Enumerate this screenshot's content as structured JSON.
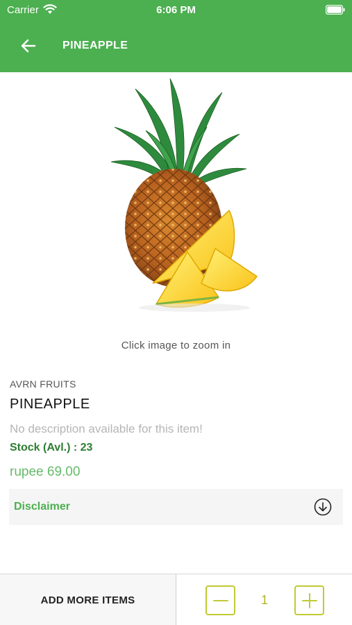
{
  "status_bar": {
    "carrier": "Carrier",
    "time": "6:06 PM"
  },
  "header": {
    "title": "PINEAPPLE",
    "back_icon": "arrow-left-icon"
  },
  "product": {
    "image_alt": "pineapple",
    "zoom_hint": "Click image to zoom in",
    "brand": "AVRN FRUITS",
    "name": "PINEAPPLE",
    "description": "No description available for this item!",
    "stock": "Stock (Avl.) : 23",
    "price": "rupee 69.00"
  },
  "disclaimer": {
    "label": "Disclaimer",
    "icon": "chevron-circle-down-icon"
  },
  "bottom_bar": {
    "add_more_label": "ADD MORE ITEMS",
    "quantity": "1"
  },
  "colors": {
    "brand_green": "#4caf50",
    "stock_green": "#2e7d32",
    "price_green": "#66bb6a",
    "qty_accent": "#c0ca33"
  }
}
